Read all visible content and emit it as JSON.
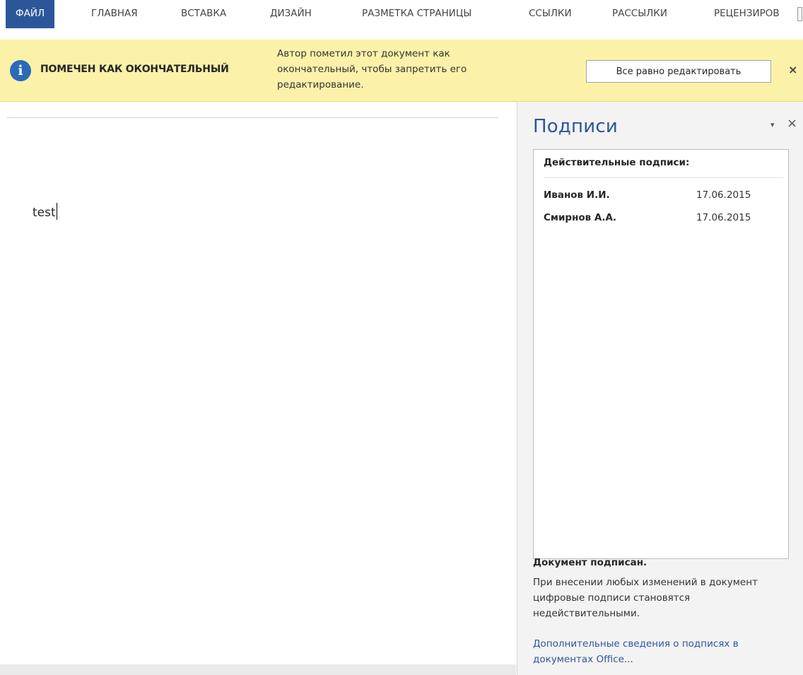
{
  "ribbon": {
    "tabs": [
      {
        "label": "ФАЙЛ"
      },
      {
        "label": "ГЛАВНАЯ"
      },
      {
        "label": "ВСТАВКА"
      },
      {
        "label": "ДИЗАЙН"
      },
      {
        "label": "РАЗМЕТКА СТРАНИЦЫ"
      },
      {
        "label": "ССЫЛКИ"
      },
      {
        "label": "РАССЫЛКИ"
      },
      {
        "label": "РЕЦЕНЗИРОВ"
      }
    ],
    "active_tab_color": "#2b579a"
  },
  "message_bar": {
    "icon": "info-icon",
    "title": "ПОМЕЧЕН КАК ОКОНЧАТЕЛЬНЫЙ",
    "text": "Автор пометил этот документ как окончательный, чтобы запретить его редактирование.",
    "button_label": "Все равно редактировать",
    "close": "×",
    "background_color": "#fcf1a8"
  },
  "document": {
    "text": "test"
  },
  "signatures_pane": {
    "title": "Подписи",
    "dropdown_glyph": "▾",
    "close": "×",
    "list_header": "Действительные подписи:",
    "signatures": [
      {
        "name": "Иванов И.И.",
        "date": "17.06.2015"
      },
      {
        "name": "Смирнов А.А.",
        "date": "17.06.2015"
      }
    ],
    "status": "Документ подписан.",
    "description": "При внесении любых изменений в документ цифровые подписи становятся недействительными.",
    "link": "Дополнительные сведения о подписях в документах Office..."
  }
}
